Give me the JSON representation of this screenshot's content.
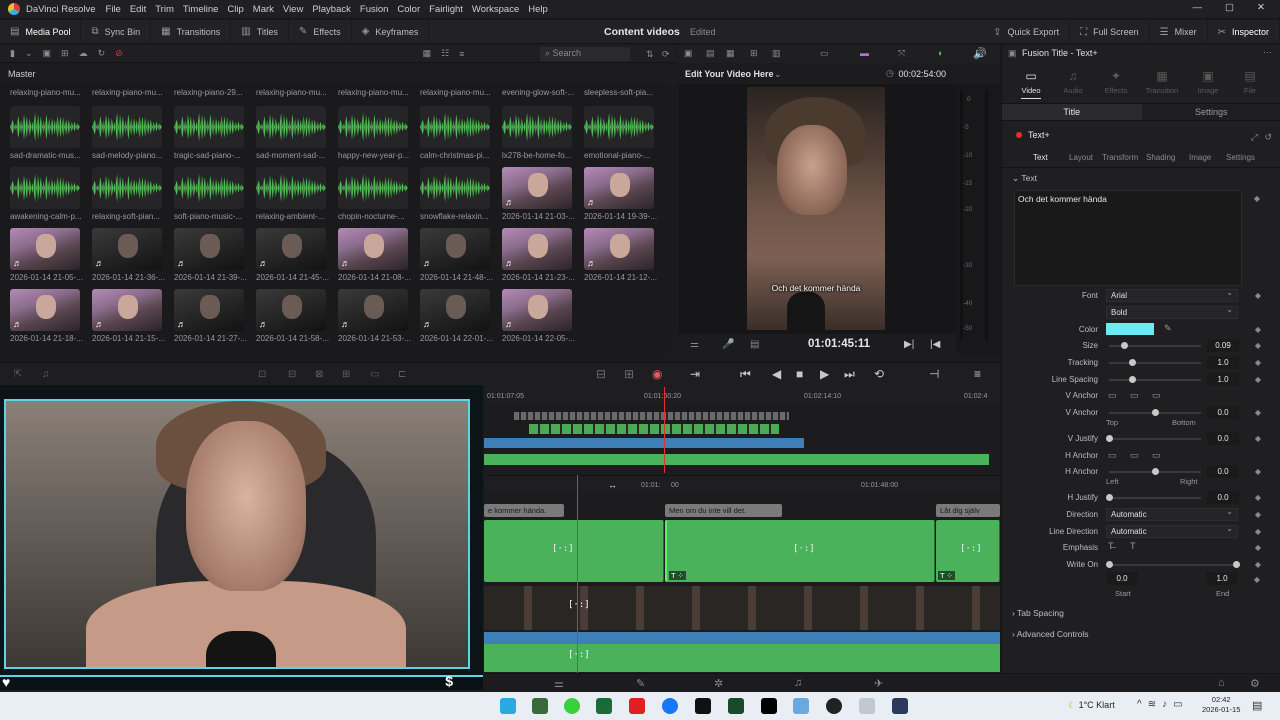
{
  "menubar": {
    "app_name": "DaVinci Resolve",
    "items": [
      "File",
      "Edit",
      "Trim",
      "Timeline",
      "Clip",
      "Mark",
      "View",
      "Playback",
      "Fusion",
      "Color",
      "Fairlight",
      "Workspace",
      "Help"
    ]
  },
  "toolbar": {
    "left": [
      "Media Pool",
      "Sync Bin",
      "Transitions",
      "Titles",
      "Effects",
      "Keyframes"
    ],
    "project_title": "Content videos",
    "project_status": "Edited",
    "right": [
      "Quick Export",
      "Full Screen",
      "Mixer",
      "Inspector"
    ]
  },
  "media_pool": {
    "search_placeholder": "Search",
    "bin": "Master",
    "top_labels": [
      "relaxing-piano-mu...",
      "relaxing-piano-mu...",
      "relaxing-piano-29...",
      "relaxing-piano-mu...",
      "relaxing-piano-mu...",
      "relaxing-piano-mu...",
      "evening-glow-soft-...",
      "sleepless-soft-pia..."
    ],
    "rows": [
      {
        "labels": [
          "sad-dramatic-mus...",
          "sad-melody-piano...",
          "tragic-sad-piano-...",
          "sad-moment-sad-...",
          "happy-new-year-p...",
          "calm-christmas-pi...",
          "lx278-be-home-fo...",
          "emotional-piano-..."
        ],
        "types": [
          "audio",
          "audio",
          "audio",
          "audio",
          "audio",
          "audio",
          "audio",
          "audio"
        ]
      },
      {
        "labels": [
          "awakening-calm-p...",
          "relaxing-soft-pian...",
          "soft-piano-music-...",
          "relaxing-ambient-...",
          "chopin-nocturne-...",
          "snowflake-relaxin...",
          "2026-01-14 21-03-...",
          "2026-01-14 19-39-..."
        ],
        "types": [
          "audio",
          "audio",
          "audio",
          "audio",
          "audio",
          "audio",
          "video",
          "video"
        ]
      },
      {
        "labels": [
          "2026-01-14 21-05-...",
          "2026-01-14 21-36-...",
          "2026-01-14 21-39-...",
          "2026-01-14 21-45-...",
          "2026-01-14 21-08-...",
          "2026-01-14 21-48-...",
          "2026-01-14 21-23-...",
          "2026-01-14 21-12-..."
        ],
        "types": [
          "video",
          "dark",
          "dark",
          "dark",
          "video",
          "dark",
          "video",
          "video"
        ]
      },
      {
        "labels": [
          "2026-01-14 21-18-...",
          "2026-01-14 21-15-...",
          "2026-01-14 21-27-...",
          "2026-01-14 21-58-...",
          "2026-01-14 21-53-...",
          "2026-01-14 22-01-...",
          "2026-01-14 22-05-..."
        ],
        "types": [
          "video",
          "video",
          "dark",
          "dark",
          "dark",
          "dark",
          "video"
        ]
      }
    ]
  },
  "viewer": {
    "title": "Edit Your Video Here",
    "duration": "00:02:54:00",
    "subtitle": "Och det kommer hända",
    "timecode": "01:01:45:11",
    "meter_ticks": [
      "0",
      "-5",
      "-10",
      "-15",
      "-20",
      "-30",
      "-40",
      "-50"
    ]
  },
  "inspector": {
    "title": "Fusion Title - Text+",
    "tabs": [
      "Video",
      "Audio",
      "Effects",
      "Transition",
      "Image",
      "File"
    ],
    "segments": [
      "Title",
      "Settings"
    ],
    "node": "Text+",
    "subtabs": [
      "Text",
      "Layout",
      "Transform",
      "Shading",
      "Image",
      "Settings"
    ],
    "section": "Text",
    "text_value": "Och det kommer hända",
    "font_label": "Font",
    "font": "Arial",
    "style": "Bold",
    "color_label": "Color",
    "color_value": "#6ee8f2",
    "size_label": "Size",
    "size": "0.09",
    "tracking_label": "Tracking",
    "tracking": "1.0",
    "line_spacing_label": "Line Spacing",
    "line_spacing": "1.0",
    "v_anchor_label": "V Anchor",
    "v_anchor": "0.0",
    "top_label": "Top",
    "bottom_label": "Bottom",
    "v_justify_label": "V Justify",
    "v_justify": "0.0",
    "h_anchor_label": "H Anchor",
    "h_anchor": "0.0",
    "left_label": "Left",
    "right_label": "Right",
    "h_justify_label": "H Justify",
    "h_justify": "0.0",
    "direction_label": "Direction",
    "direction": "Automatic",
    "line_direction_label": "Line Direction",
    "line_direction": "Automatic",
    "emphasis_label": "Emphasis",
    "write_on_label": "Write On",
    "write_on_start": "0.0",
    "write_on_end": "1.0",
    "start_label": "Start",
    "end_label": "End",
    "sections": [
      "Tab Spacing",
      "Advanced Controls"
    ]
  },
  "timeline": {
    "ruler_top": [
      "01:01:07:05",
      "01:01:50:20",
      "01:02:14:10",
      "01:02:4"
    ],
    "ruler_bottom": [
      "01:01:",
      "00",
      "01:01:48:00"
    ],
    "title_clips": [
      "e kommer hända.",
      "Men om du inte vill det.",
      "Låt dig själv"
    ]
  },
  "taskbar": {
    "weather": "1°C  Klart",
    "time": "02:42",
    "date": "2026-01-15"
  }
}
